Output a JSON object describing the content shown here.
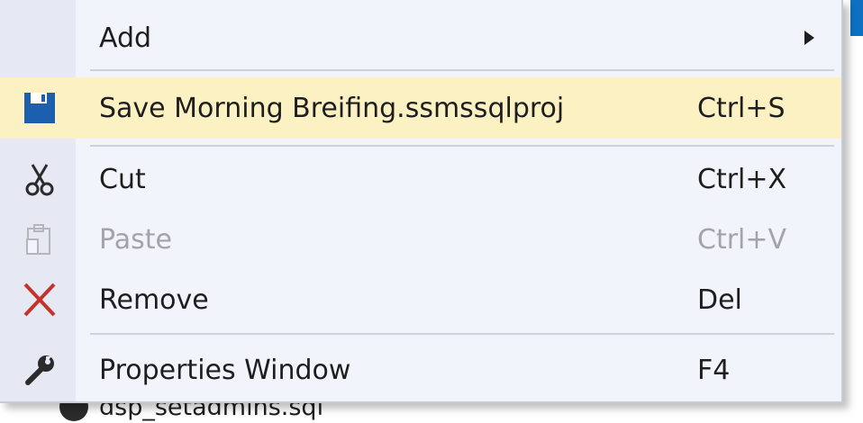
{
  "background": {
    "tree_item_label": "dsp_setadmins.sql"
  },
  "menu": {
    "items": [
      {
        "label": "Add",
        "shortcut": "",
        "has_submenu": true,
        "enabled": true,
        "icon": "none"
      },
      {
        "label": "Save Morning Breifing.ssmssqlproj",
        "shortcut": "Ctrl+S",
        "has_submenu": false,
        "enabled": true,
        "icon": "save-icon",
        "highlighted": true
      },
      {
        "label": "Cut",
        "shortcut": "Ctrl+X",
        "has_submenu": false,
        "enabled": true,
        "icon": "scissors-icon"
      },
      {
        "label": "Paste",
        "shortcut": "Ctrl+V",
        "has_submenu": false,
        "enabled": false,
        "icon": "paste-icon"
      },
      {
        "label": "Remove",
        "shortcut": "Del",
        "has_submenu": false,
        "enabled": true,
        "icon": "close-icon"
      },
      {
        "label": "Properties Window",
        "shortcut": "F4",
        "has_submenu": false,
        "enabled": true,
        "icon": "wrench-icon"
      }
    ]
  },
  "colors": {
    "menu_background": "#f2f4fc",
    "gutter": "#e6e8f4",
    "highlight": "#fcf1c2",
    "save_icon": "#1b5fae",
    "remove_icon": "#c4332a",
    "disabled_text": "#a2a4a8"
  }
}
